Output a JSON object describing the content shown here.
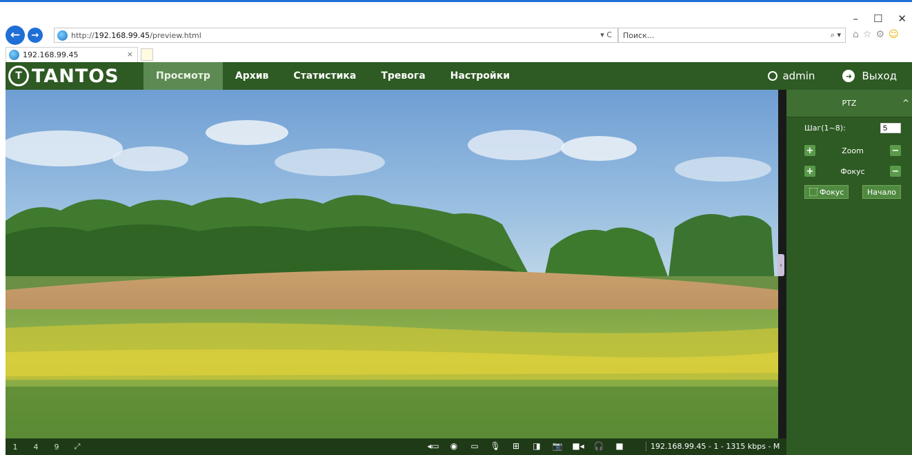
{
  "browser": {
    "url_prefix": "http://",
    "url_host": "192.168.99.45",
    "url_path": "/preview.html",
    "url_controls": "▾ C",
    "search_placeholder": "Поиск...",
    "search_controls": "⌕ ▾",
    "tab_title": "192.168.99.45",
    "tab_close": "×",
    "win_minimize": "–",
    "win_maximize": "☐",
    "win_close": "✕",
    "back_glyph": "←",
    "forward_glyph": "→",
    "icon_home": "⌂",
    "icon_star": "☆",
    "icon_gear": "⚙",
    "icon_smile": "☺"
  },
  "app": {
    "logo_mark": "T",
    "logo_text": "TANTOS",
    "menu": [
      {
        "label": "Просмотр",
        "active": true
      },
      {
        "label": "Архив"
      },
      {
        "label": "Статистика"
      },
      {
        "label": "Тревога"
      },
      {
        "label": "Настройки"
      }
    ],
    "user": "admin",
    "logout_glyph": "➜",
    "logout": "Выход"
  },
  "video": {
    "collapse_glyph": "›"
  },
  "ptz": {
    "title": "PTZ",
    "collapse_glyph": "^",
    "step_label": "Шаг(1~8):",
    "step_value": "5",
    "plus_glyph": "+",
    "minus_glyph": "−",
    "zoom_label": "Zoom",
    "focus_label": "Фокус",
    "focus_button": "Фокус",
    "home_button": "Начало"
  },
  "bottom": {
    "layouts": [
      "1",
      "4",
      "9",
      "⤢"
    ],
    "tools": [
      "◂▭",
      "◉",
      "▭",
      "🎙",
      "⊞",
      "◨",
      "📷",
      "■◂",
      "🎧",
      "■"
    ],
    "status": "192.168.99.45 - 1 - 1315 kbps - M"
  },
  "colors": {
    "header": "#2e5a23",
    "active_tab": "#5d8a52",
    "ie_blue": "#1f6fd6"
  }
}
